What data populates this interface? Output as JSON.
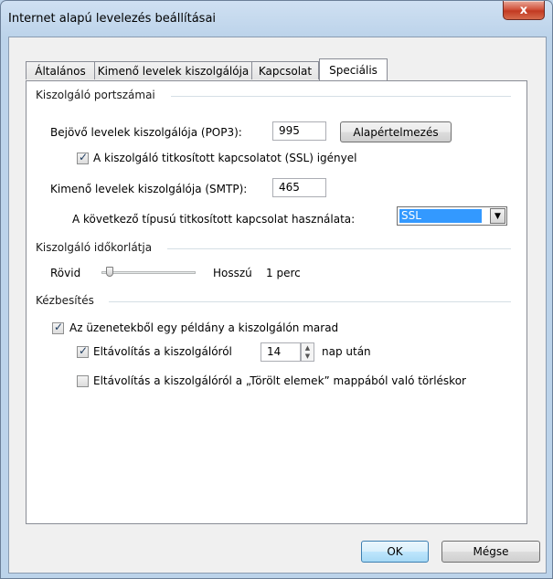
{
  "window": {
    "title": "Internet alapú levelezés beállításai",
    "close_glyph": "x"
  },
  "tabs": [
    {
      "label": "Általános"
    },
    {
      "label": "Kimenő levelek kiszolgálója"
    },
    {
      "label": "Kapcsolat"
    },
    {
      "label": "Speciális"
    }
  ],
  "server_ports": {
    "group_label": "Kiszolgáló portszámai",
    "incoming_label": "Bejövő levelek kiszolgálója (POP3):",
    "incoming_value": "995",
    "default_button": "Alapértelmezés",
    "ssl_checkbox_label": "A kiszolgáló titkosított kapcsolatot (SSL) igényel",
    "ssl_checked": true,
    "outgoing_label": "Kimenő levelek kiszolgálója (SMTP):",
    "outgoing_value": "465",
    "encryption_label": "A következő típusú titkosított kapcsolat használata:",
    "encryption_value": "SSL"
  },
  "timeout": {
    "group_label": "Kiszolgáló időkorlátja",
    "short_label": "Rövid",
    "long_label": "Hosszú",
    "value_text": "1 perc",
    "slider_fraction": 0.05
  },
  "delivery": {
    "group_label": "Kézbesítés",
    "leave_copy_label": "Az üzenetekből egy példány a kiszolgálón marad",
    "leave_copy_checked": true,
    "remove_after_label": "Eltávolítás a kiszolgálóról",
    "remove_after_checked": true,
    "remove_after_days": "14",
    "remove_after_suffix": "nap után",
    "remove_deleted_label": "Eltávolítás a kiszolgálóról a „Törölt elemek” mappából való törléskor",
    "remove_deleted_checked": false
  },
  "footer": {
    "ok": "OK",
    "cancel": "Mégse"
  }
}
